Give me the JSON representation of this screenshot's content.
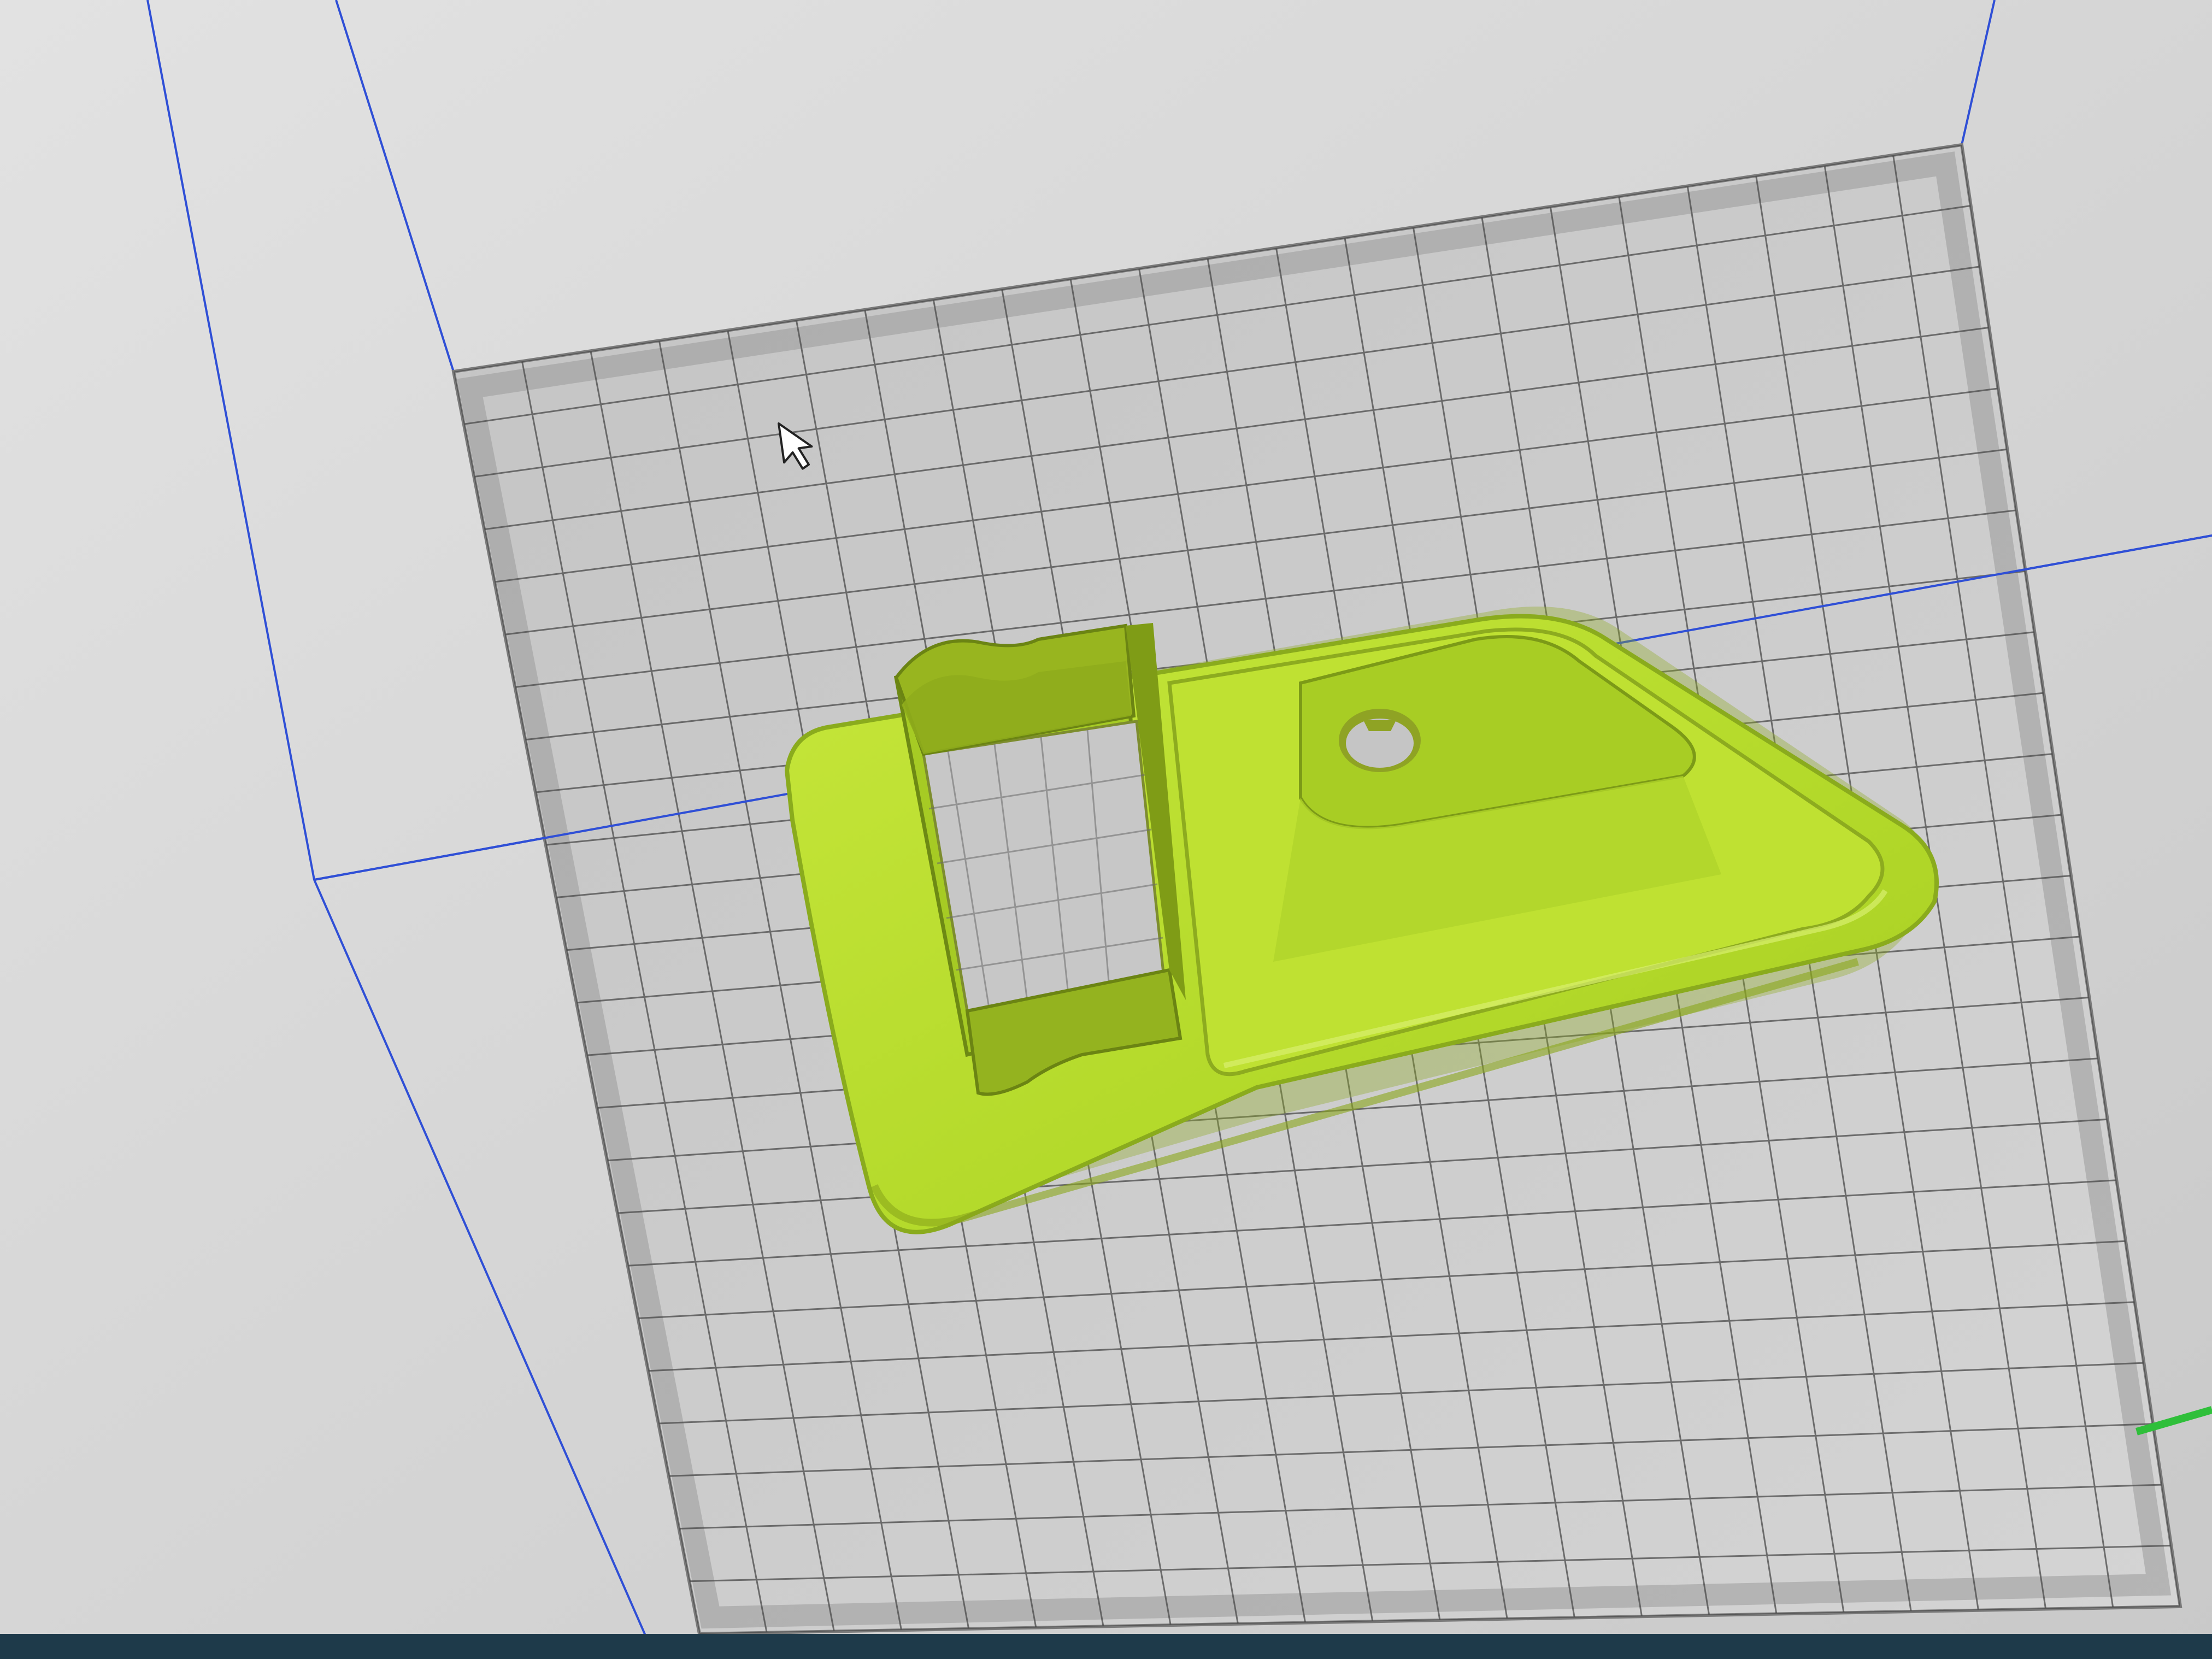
{
  "viewport": {
    "background_color": "#d6d6d6",
    "build_plate_color": "#bdbdbd",
    "grid_line_color": "#4a4a4a",
    "build_volume_edge_color": "#2f4fd6",
    "model_color": "#b6dc2a",
    "model_shadow_color": "#7e9f16",
    "cursor_icon": "arrow-cursor-icon",
    "axis_indicator_color": "#2fbf3a"
  },
  "taskbar": {
    "color": "#1e3a4a"
  }
}
